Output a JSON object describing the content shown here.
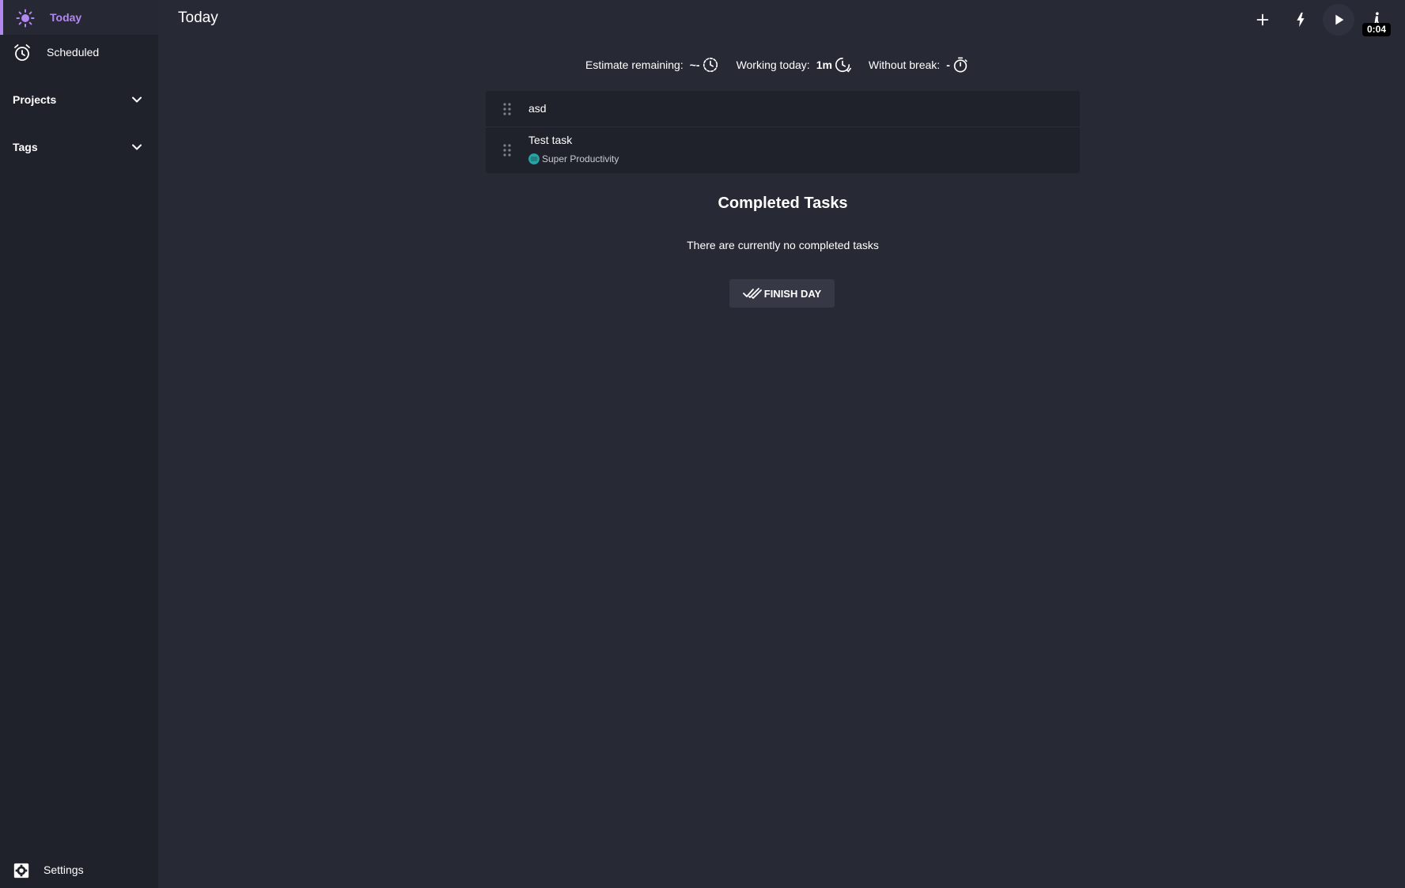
{
  "sidebar": {
    "nav": [
      {
        "label": "Today",
        "icon": "sun-icon",
        "active": true
      },
      {
        "label": "Scheduled",
        "icon": "alarm-clock-icon",
        "active": false
      }
    ],
    "sections": [
      {
        "label": "Projects",
        "icon": "chevron-down-icon"
      },
      {
        "label": "Tags",
        "icon": "chevron-down-icon"
      }
    ],
    "settings": {
      "label": "Settings",
      "icon": "gear-icon"
    }
  },
  "header": {
    "title": "Today",
    "buttons": [
      {
        "name": "add-task",
        "icon": "plus-icon"
      },
      {
        "name": "quick-action",
        "icon": "flash-icon"
      },
      {
        "name": "play",
        "icon": "play-icon"
      },
      {
        "name": "take-break",
        "icon": "walking-person-icon"
      }
    ],
    "break_timer": "0:04"
  },
  "metrics": [
    {
      "label": "Estimate remaining:",
      "value": "~-",
      "icon": "clock-dashed-icon"
    },
    {
      "label": "Working today:",
      "value": "1m",
      "icon": "clock-icon"
    },
    {
      "label": "Without break:",
      "value": "-",
      "icon": "stopwatch-icon"
    }
  ],
  "tasks": [
    {
      "title": "asd",
      "project": null
    },
    {
      "title": "Test task",
      "project": "Super Productivity"
    }
  ],
  "completed": {
    "title": "Completed Tasks",
    "empty_text": "There are currently no completed tasks",
    "finish_button": "FINISH DAY"
  },
  "colors": {
    "accent": "#b288f0",
    "background": "#272a35",
    "sidebar": "#20222b",
    "project_dot": "#28a4a6"
  }
}
